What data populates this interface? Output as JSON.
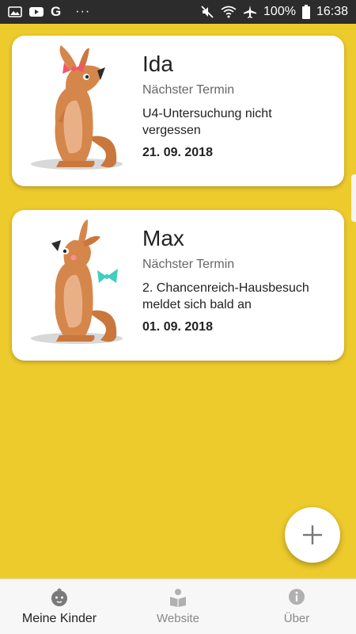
{
  "status_bar": {
    "left_icons": [
      "image-icon",
      "youtube-icon",
      "google-icon",
      "more-dots-icon"
    ],
    "google_letter": "G",
    "dots": "···",
    "right_icons": [
      "mute-icon",
      "wifi-icon",
      "airplane-icon",
      "battery-icon"
    ],
    "battery_text": "100%",
    "time": "16:38"
  },
  "children": [
    {
      "name": "Ida",
      "termin_label": "Nächster Termin",
      "termin_text": "U4-Untersuchung nicht vergessen",
      "termin_date": "21. 09. 2018",
      "bow_color": "#F4566A"
    },
    {
      "name": "Max",
      "termin_label": "Nächster Termin",
      "termin_text": "2. Chancenreich-Hausbesuch meldet sich bald an",
      "termin_date": "01. 09. 2018",
      "bow_color": "#3ECFC0"
    }
  ],
  "fab": {
    "icon": "plus-icon"
  },
  "bottom_nav": [
    {
      "label": "Meine Kinder",
      "icon": "baby-face-icon",
      "active": true
    },
    {
      "label": "Website",
      "icon": "reading-person-icon",
      "active": false
    },
    {
      "label": "Über",
      "icon": "info-icon",
      "active": false
    }
  ],
  "colors": {
    "background": "#EECB2C",
    "status_bar": "#2C2C2C",
    "card": "#FFFFFF",
    "kangaroo": "#D5864B",
    "nav_background": "#F7F7F7"
  }
}
